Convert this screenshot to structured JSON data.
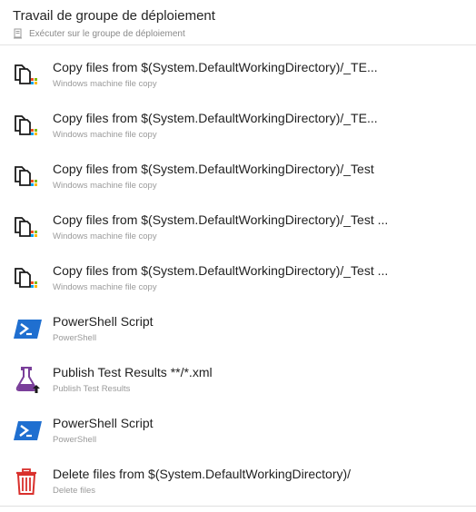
{
  "header": {
    "title": "Travail de groupe de déploiement",
    "subtitle": "Exécuter sur le groupe de déploiement",
    "icon": "server-icon"
  },
  "tasks": [
    {
      "title": "Copy files from $(System.DefaultWorkingDirectory)/_TE...",
      "subtitle": "Windows machine file copy",
      "icon": "file-copy-icon"
    },
    {
      "title": "Copy files from $(System.DefaultWorkingDirectory)/_TE...",
      "subtitle": "Windows machine file copy",
      "icon": "file-copy-icon"
    },
    {
      "title": "Copy files from $(System.DefaultWorkingDirectory)/_Test",
      "subtitle": "Windows machine file copy",
      "icon": "file-copy-icon"
    },
    {
      "title": "Copy files from $(System.DefaultWorkingDirectory)/_Test ...",
      "subtitle": "Windows machine file copy",
      "icon": "file-copy-icon"
    },
    {
      "title": "Copy files from $(System.DefaultWorkingDirectory)/_Test ...",
      "subtitle": "Windows machine file copy",
      "icon": "file-copy-icon"
    },
    {
      "title": "PowerShell Script",
      "subtitle": "PowerShell",
      "icon": "powershell-icon"
    },
    {
      "title": "Publish Test Results **/*.xml",
      "subtitle": "Publish Test Results",
      "icon": "flask-upload-icon"
    },
    {
      "title": "PowerShell Script",
      "subtitle": "PowerShell",
      "icon": "powershell-icon"
    },
    {
      "title": "Delete files from $(System.DefaultWorkingDirectory)/",
      "subtitle": "Delete files",
      "icon": "trash-icon"
    }
  ],
  "colors": {
    "powershell": "#1f6fd0",
    "flask": "#7a3f9a",
    "trash": "#d9302c",
    "windows_red": "#f25022",
    "windows_green": "#7fba00",
    "windows_blue": "#00a4ef",
    "windows_yellow": "#ffb900"
  }
}
